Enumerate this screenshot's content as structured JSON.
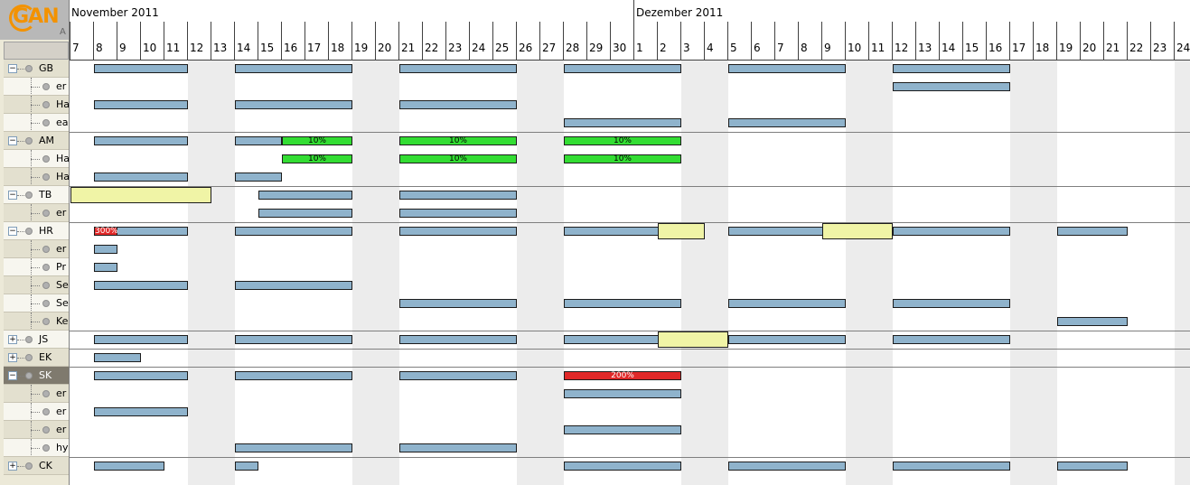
{
  "app": {
    "logo_text": "GAN",
    "logo_sub": "A"
  },
  "timeline": {
    "months": [
      {
        "label": "November 2011",
        "start_day_index": 0
      },
      {
        "label": "Dezember 2011",
        "start_day_index": 24
      }
    ],
    "days": [
      "7",
      "8",
      "9",
      "10",
      "11",
      "12",
      "13",
      "14",
      "15",
      "16",
      "17",
      "18",
      "19",
      "20",
      "21",
      "22",
      "23",
      "24",
      "25",
      "26",
      "27",
      "28",
      "29",
      "30",
      "1",
      "2",
      "3",
      "4",
      "5",
      "6",
      "7",
      "8",
      "9",
      "10",
      "11",
      "12",
      "13",
      "14",
      "15",
      "16",
      "17",
      "18",
      "19",
      "20",
      "21",
      "22",
      "23",
      "24"
    ],
    "weekend_day_indices": [
      5,
      6,
      12,
      13,
      19,
      20,
      26,
      27,
      33,
      34,
      40,
      41,
      47
    ]
  },
  "tree": [
    {
      "label": "GB",
      "level": 0,
      "expander": "−"
    },
    {
      "label": "er",
      "level": 1
    },
    {
      "label": "Ha",
      "level": 1
    },
    {
      "label": "ea",
      "level": 1
    },
    {
      "label": "AM",
      "level": 0,
      "expander": "−"
    },
    {
      "label": "Ha",
      "level": 1
    },
    {
      "label": "Ha",
      "level": 1
    },
    {
      "label": "TB",
      "level": 0,
      "expander": "−"
    },
    {
      "label": "er",
      "level": 1
    },
    {
      "label": "HR",
      "level": 0,
      "expander": "−"
    },
    {
      "label": "er",
      "level": 1
    },
    {
      "label": "Pr",
      "level": 1
    },
    {
      "label": "Se",
      "level": 1
    },
    {
      "label": "Se",
      "level": 1
    },
    {
      "label": "Ke",
      "level": 1
    },
    {
      "label": "JS",
      "level": 0,
      "expander": "+"
    },
    {
      "label": "EK",
      "level": 0,
      "expander": "+"
    },
    {
      "label": "SK",
      "level": 0,
      "expander": "−",
      "selected": true
    },
    {
      "label": "er",
      "level": 1
    },
    {
      "label": "er",
      "level": 1
    },
    {
      "label": "er",
      "level": 1
    },
    {
      "label": "hy",
      "level": 1
    },
    {
      "label": "CK",
      "level": 0,
      "expander": "+"
    }
  ],
  "bars": [
    {
      "row": 0,
      "start": 1,
      "end": 5
    },
    {
      "row": 0,
      "start": 7,
      "end": 12
    },
    {
      "row": 0,
      "start": 14,
      "end": 19
    },
    {
      "row": 0,
      "start": 21,
      "end": 26
    },
    {
      "row": 0,
      "start": 28,
      "end": 33
    },
    {
      "row": 0,
      "start": 35,
      "end": 40
    },
    {
      "row": 1,
      "start": 35,
      "end": 40
    },
    {
      "row": 2,
      "start": 1,
      "end": 5
    },
    {
      "row": 2,
      "start": 7,
      "end": 12
    },
    {
      "row": 2,
      "start": 14,
      "end": 19
    },
    {
      "row": 3,
      "start": 21,
      "end": 26
    },
    {
      "row": 3,
      "start": 28,
      "end": 33
    },
    {
      "row": 4,
      "start": 1,
      "end": 5
    },
    {
      "row": 4,
      "start": 7,
      "end": 9
    },
    {
      "row": 4,
      "start": 9,
      "end": 12,
      "color": "green",
      "label": "10%"
    },
    {
      "row": 4,
      "start": 14,
      "end": 19,
      "color": "green",
      "label": "10%"
    },
    {
      "row": 4,
      "start": 21,
      "end": 26,
      "color": "green",
      "label": "10%"
    },
    {
      "row": 5,
      "start": 9,
      "end": 12,
      "color": "green",
      "label": "10%"
    },
    {
      "row": 5,
      "start": 14,
      "end": 19,
      "color": "green",
      "label": "10%"
    },
    {
      "row": 5,
      "start": 21,
      "end": 26,
      "color": "green",
      "label": "10%"
    },
    {
      "row": 6,
      "start": 1,
      "end": 5
    },
    {
      "row": 6,
      "start": 7,
      "end": 9
    },
    {
      "row": 7,
      "start": 0,
      "end": 6,
      "color": "yellow"
    },
    {
      "row": 7,
      "start": 8,
      "end": 12
    },
    {
      "row": 7,
      "start": 14,
      "end": 19
    },
    {
      "row": 8,
      "start": 8,
      "end": 12
    },
    {
      "row": 8,
      "start": 14,
      "end": 19
    },
    {
      "row": 9,
      "start": 1,
      "end": 5
    },
    {
      "row": 9,
      "start": 1,
      "end": 2,
      "color": "red",
      "label": "300%"
    },
    {
      "row": 9,
      "start": 7,
      "end": 12
    },
    {
      "row": 9,
      "start": 14,
      "end": 19
    },
    {
      "row": 9,
      "start": 21,
      "end": 26
    },
    {
      "row": 9,
      "start": 25,
      "end": 27,
      "color": "yellow"
    },
    {
      "row": 9,
      "start": 28,
      "end": 33
    },
    {
      "row": 9,
      "start": 32,
      "end": 35,
      "color": "yellow"
    },
    {
      "row": 9,
      "start": 35,
      "end": 40
    },
    {
      "row": 9,
      "start": 42,
      "end": 45
    },
    {
      "row": 10,
      "start": 1,
      "end": 2
    },
    {
      "row": 11,
      "start": 1,
      "end": 2
    },
    {
      "row": 12,
      "start": 1,
      "end": 5
    },
    {
      "row": 12,
      "start": 7,
      "end": 12
    },
    {
      "row": 13,
      "start": 14,
      "end": 19
    },
    {
      "row": 13,
      "start": 21,
      "end": 26
    },
    {
      "row": 13,
      "start": 28,
      "end": 33
    },
    {
      "row": 13,
      "start": 35,
      "end": 40
    },
    {
      "row": 14,
      "start": 42,
      "end": 45
    },
    {
      "row": 15,
      "start": 1,
      "end": 5
    },
    {
      "row": 15,
      "start": 7,
      "end": 12
    },
    {
      "row": 15,
      "start": 14,
      "end": 19
    },
    {
      "row": 15,
      "start": 21,
      "end": 26
    },
    {
      "row": 15,
      "start": 25,
      "end": 28,
      "color": "yellow"
    },
    {
      "row": 15,
      "start": 28,
      "end": 33
    },
    {
      "row": 15,
      "start": 35,
      "end": 40
    },
    {
      "row": 16,
      "start": 1,
      "end": 3
    },
    {
      "row": 17,
      "start": 1,
      "end": 5
    },
    {
      "row": 17,
      "start": 7,
      "end": 12
    },
    {
      "row": 17,
      "start": 14,
      "end": 19
    },
    {
      "row": 17,
      "start": 21,
      "end": 26,
      "color": "red",
      "label": "200%"
    },
    {
      "row": 18,
      "start": 21,
      "end": 26
    },
    {
      "row": 19,
      "start": 1,
      "end": 5
    },
    {
      "row": 20,
      "start": 21,
      "end": 26
    },
    {
      "row": 21,
      "start": 7,
      "end": 12
    },
    {
      "row": 21,
      "start": 14,
      "end": 19
    },
    {
      "row": 22,
      "start": 1,
      "end": 4
    },
    {
      "row": 22,
      "start": 7,
      "end": 8
    },
    {
      "row": 22,
      "start": 21,
      "end": 26
    },
    {
      "row": 22,
      "start": 28,
      "end": 33
    },
    {
      "row": 22,
      "start": 35,
      "end": 40
    },
    {
      "row": 22,
      "start": 42,
      "end": 45
    }
  ]
}
